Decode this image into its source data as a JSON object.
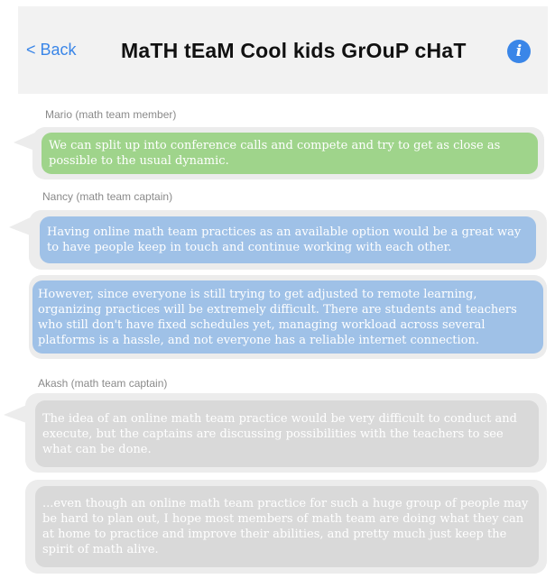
{
  "header": {
    "back_label": "< Back",
    "title": "MaTH tEaM Cool kids GrOuP cHaT",
    "info_label": "i"
  },
  "messages": [
    {
      "sender": "Mario (math team member)",
      "text": "We can split up into conference calls and compete and try to get as close as possible to the usual dynamic."
    },
    {
      "sender": "Nancy (math team captain)",
      "text": "Having online math team practices as an available option would be a great way to have people keep in touch and continue working with each other."
    },
    {
      "sender": "",
      "text": "However, since everyone is still trying to get adjusted to remote learning, organizing practices will be extremely difficult. There are students and teachers who still don't have fixed schedules yet, managing workload across several platforms is a hassle, and not everyone has a reliable internet connection."
    },
    {
      "sender": "Akash (math team captain)",
      "text": "The idea of an online math team practice would be very difficult to conduct and execute, but the captains are discussing possibilities with the teachers to see what can be done."
    },
    {
      "sender": "",
      "text": "...even though an online math team practice for such a huge group of people may be hard to plan out, I hope most members of math team are doing what they can at home to practice and improve their abilities, and pretty much just keep the spirit of math alive."
    }
  ],
  "colors": {
    "accent": "#3a86e8",
    "mario_bubble": "#9fd48b",
    "nancy_bubble": "#9fc1e7",
    "akash_bubble": "#d9d9d9",
    "frame": "#ececec"
  },
  "icons": {
    "info": "info-icon"
  }
}
